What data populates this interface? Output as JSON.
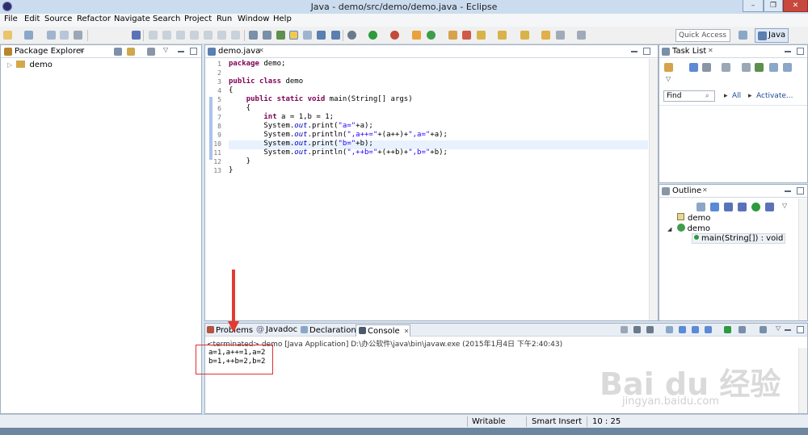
{
  "window": {
    "title": "Java - demo/src/demo/demo.java - Eclipse",
    "close": "✕",
    "minimize": "–",
    "maximize": "❐"
  },
  "menu": [
    "File",
    "Edit",
    "Source",
    "Refactor",
    "Navigate",
    "Search",
    "Project",
    "Run",
    "Window",
    "Help"
  ],
  "toolbar": {
    "quick_access_placeholder": "Quick Access",
    "perspective": "Java"
  },
  "package_explorer": {
    "tab": "Package Explorer",
    "project": "demo"
  },
  "editor": {
    "tab": "demo.java",
    "line_numbers": [
      "1",
      "2",
      "3",
      "4",
      "5",
      "6",
      "7",
      "8",
      "9",
      "10",
      "11",
      "12",
      "13"
    ],
    "lines": [
      "package demo;",
      "",
      "public class demo",
      "{",
      "    public static void main(String[] args)",
      "    {",
      "        int a = 1,b = 1;",
      "        System.out.print(\"a=\"+a);",
      "        System.out.println(\",a++=\"+(a++)+\",a=\"+a);",
      "        System.out.print(\"b=\"+b);",
      "        System.out.println(\",++b=\"+(++b)+\",b=\"+b);",
      "    }",
      "}"
    ]
  },
  "task_list": {
    "tab": "Task List",
    "find_placeholder": "Find",
    "all": "All",
    "activate": "Activate..."
  },
  "outline": {
    "tab": "Outline",
    "items": [
      "demo",
      "demo",
      "main(String[]) : void"
    ]
  },
  "console": {
    "tabs": [
      "Problems",
      "Javadoc",
      "Declaration",
      "Console"
    ],
    "status": "<terminated> demo [Java Application] D:\\办公软件\\java\\bin\\javaw.exe (2015年1月4日 下午2:40:43)",
    "output": [
      "a=1,a++=1,a=2",
      "b=1,++b=2,b=2"
    ]
  },
  "statusbar": {
    "mode": "Writable",
    "insert": "Smart Insert",
    "position": "10 : 25"
  },
  "watermark": {
    "logo": "Bai du 经验",
    "url": "jingyan.baidu.com"
  },
  "colors": {
    "keyword": "#7f0055",
    "string": "#2a00ff",
    "field": "#0000c0",
    "annotation": "#e23b32"
  }
}
